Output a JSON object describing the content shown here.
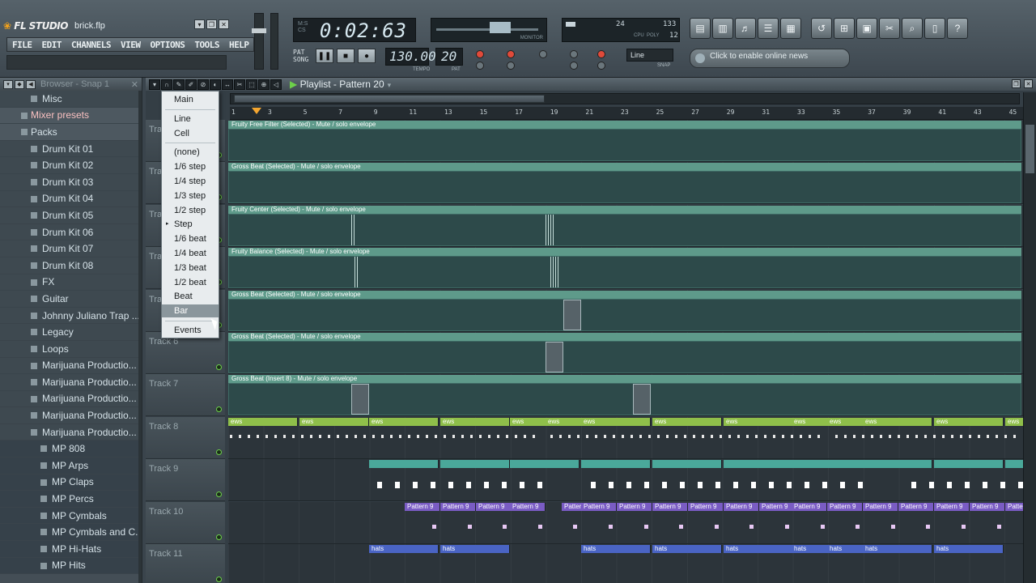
{
  "app": {
    "title": "FL STUDIO",
    "filename": "brick.flp"
  },
  "menu": [
    "FILE",
    "EDIT",
    "CHANNELS",
    "VIEW",
    "OPTIONS",
    "TOOLS",
    "HELP"
  ],
  "transport": {
    "time": "0:02:63",
    "tempo": "130.000",
    "tempo_label": "TEMPO",
    "pattern": "20",
    "pattern_label": "PAT",
    "monitor_label": "MONITOR",
    "snap": "Line",
    "snap_label": "SNAP",
    "cpu_values": [
      "24",
      "133",
      "12"
    ],
    "cpu_labels": [
      "CPU",
      "POLY"
    ]
  },
  "news": "Click to enable online news",
  "browser": {
    "title": "Browser - Snap 1",
    "items": [
      {
        "label": "Misc",
        "level": 1
      },
      {
        "label": "Mixer presets",
        "level": 0,
        "selected": true
      },
      {
        "label": "Packs",
        "level": 0
      },
      {
        "label": "Drum Kit 01",
        "level": 1
      },
      {
        "label": "Drum Kit 02",
        "level": 1
      },
      {
        "label": "Drum Kit 03",
        "level": 1
      },
      {
        "label": "Drum Kit 04",
        "level": 1
      },
      {
        "label": "Drum Kit 05",
        "level": 1
      },
      {
        "label": "Drum Kit 06",
        "level": 1
      },
      {
        "label": "Drum Kit 07",
        "level": 1
      },
      {
        "label": "Drum Kit 08",
        "level": 1
      },
      {
        "label": "FX",
        "level": 1
      },
      {
        "label": "Guitar",
        "level": 1
      },
      {
        "label": "Johnny Juliano Trap ...",
        "level": 1
      },
      {
        "label": "Legacy",
        "level": 1
      },
      {
        "label": "Loops",
        "level": 1
      },
      {
        "label": "Marijuana Productio...",
        "level": 1
      },
      {
        "label": "Marijuana Productio...",
        "level": 1
      },
      {
        "label": "Marijuana Productio...",
        "level": 1
      },
      {
        "label": "Marijuana Productio...",
        "level": 1
      },
      {
        "label": "Marijuana Productio...",
        "level": 1
      },
      {
        "label": "MP 808",
        "level": 2
      },
      {
        "label": "MP Arps",
        "level": 2
      },
      {
        "label": "MP Claps",
        "level": 2
      },
      {
        "label": "MP Percs",
        "level": 2
      },
      {
        "label": "MP Cymbals",
        "level": 2
      },
      {
        "label": "MP Cymbals and C...",
        "level": 2
      },
      {
        "label": "MP Hi-Hats",
        "level": 2
      },
      {
        "label": "MP Hits",
        "level": 2
      }
    ]
  },
  "playlist": {
    "title": "Playlist - Pattern 20",
    "ruler": [
      "1",
      "3",
      "5",
      "7",
      "9",
      "11",
      "13",
      "15",
      "17",
      "19",
      "21",
      "23",
      "25",
      "27",
      "29",
      "31",
      "33",
      "35",
      "37",
      "39",
      "41",
      "43",
      "45"
    ],
    "tracks": [
      {
        "name": "Track 1",
        "clip": "Fruity Free Filter (Selected) - Mute / solo envelope"
      },
      {
        "name": "Track 2",
        "clip": "Gross Beat (Selected) - Mute / solo envelope"
      },
      {
        "name": "Track 3",
        "clip": "Fruity Center (Selected) - Mute / solo envelope"
      },
      {
        "name": "Track 4",
        "clip": "Fruity Balance (Selected) - Mute / solo envelope"
      },
      {
        "name": "Track 5",
        "clip": "Gross Beat (Selected) - Mute / solo envelope"
      },
      {
        "name": "Track 6",
        "clip": "Gross Beat (Selected) - Mute / solo envelope"
      },
      {
        "name": "Track 7",
        "clip": "Gross Beat (Insert 8) - Mute / solo envelope"
      },
      {
        "name": "Track 8",
        "clip": "ews"
      },
      {
        "name": "Track 9",
        "clip": ""
      },
      {
        "name": "Track 10",
        "clip": "Pattern 9"
      },
      {
        "name": "Track 11",
        "clip": "hats"
      }
    ]
  },
  "snap_menu": {
    "items": [
      "Main",
      "Line",
      "Cell",
      "(none)",
      "1/6 step",
      "1/4 step",
      "1/3 step",
      "1/2 step",
      "Step",
      "1/6 beat",
      "1/4 beat",
      "1/3 beat",
      "1/2 beat",
      "Beat",
      "Bar",
      "Events"
    ],
    "checked": "Step",
    "highlighted": "Bar"
  },
  "colors": {
    "automation": "#5e9a8a",
    "pattern_green": "#8fbf4a",
    "pattern_teal": "#4aa89a",
    "pattern_purple": "#7a5cc4",
    "pattern_blue": "#4a64c4"
  }
}
